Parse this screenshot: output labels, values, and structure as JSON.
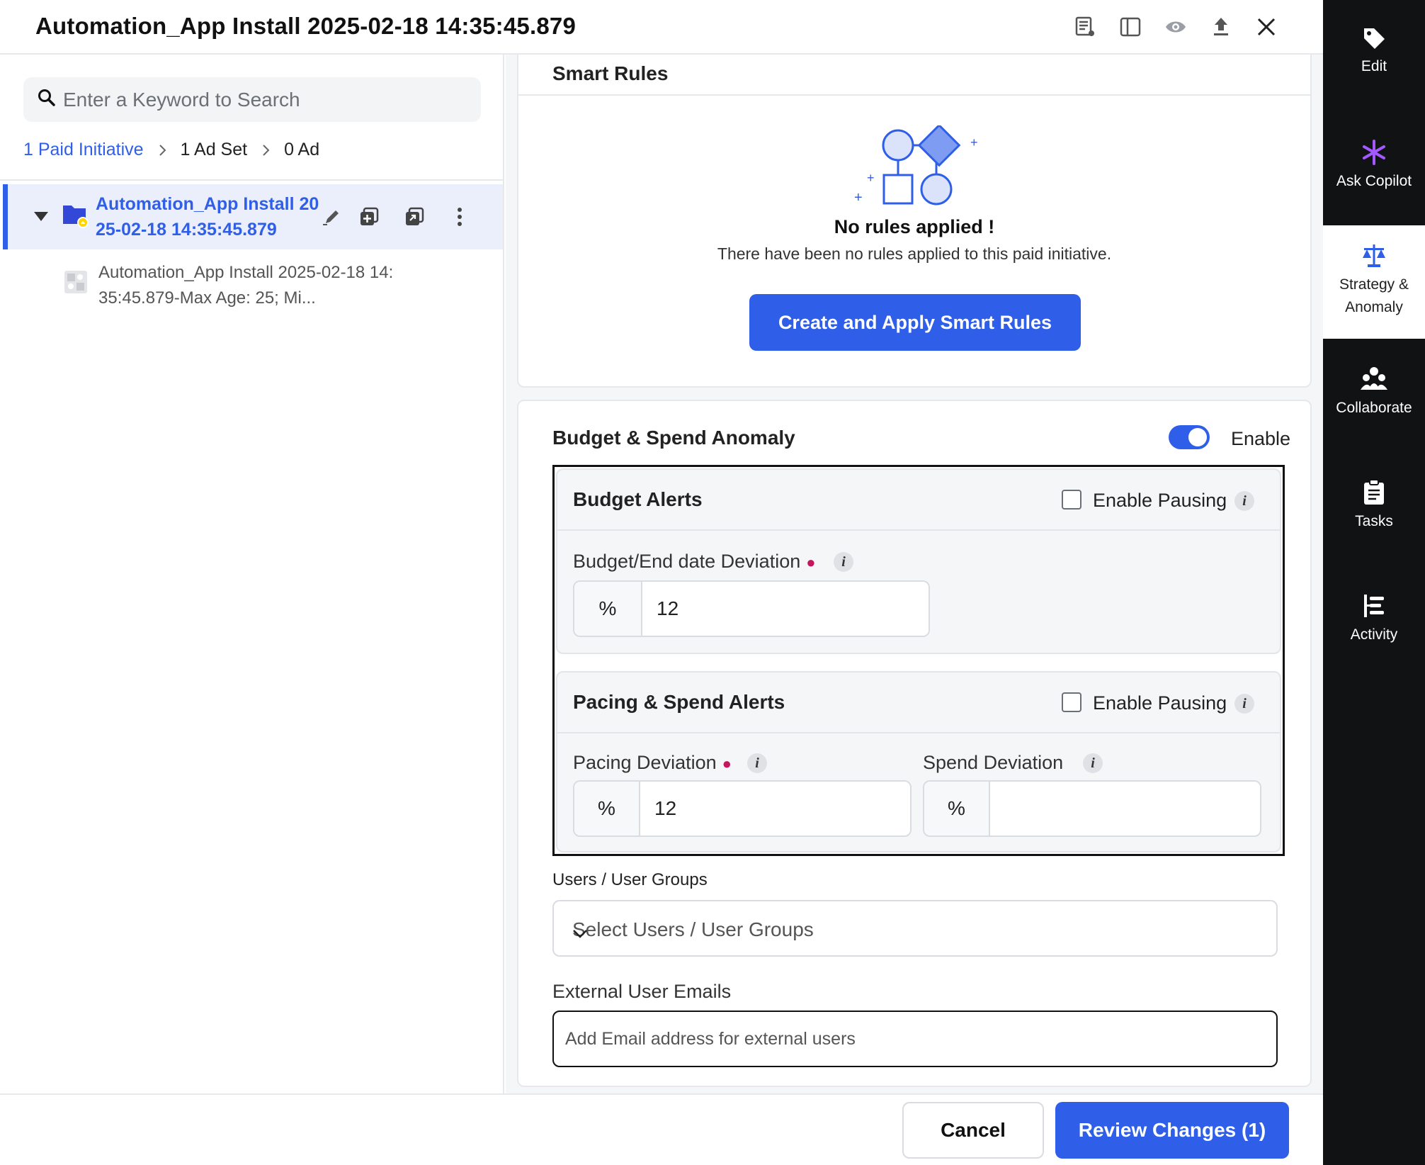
{
  "window": {
    "title": "Automation_App Install 2025-02-18 14:35:45.879"
  },
  "header_icons": [
    "list-settings-icon",
    "split-view-icon",
    "eye-icon",
    "upload-icon",
    "close-icon"
  ],
  "left": {
    "search_placeholder": "Enter a Keyword to Search",
    "breadcrumb": {
      "initiative": "1 Paid Initiative",
      "adset": "1 Ad Set",
      "ad": "0 Ad"
    },
    "tree_item": {
      "name": "Automation_App Install 2025-02-18 14:35:45.879"
    },
    "child_item": {
      "name": "Automation_App Install 2025-02-18 14:35:45.879-Max Age: 25; Mi..."
    }
  },
  "smart_rules": {
    "title": "Smart Rules",
    "empty_title": "No rules applied !",
    "empty_desc": "There have been no rules applied to this paid initiative.",
    "create_button": "Create and Apply Smart Rules"
  },
  "anomaly": {
    "title": "Budget & Spend Anomaly",
    "toggle_label": "Enable",
    "toggle_on": true,
    "budget_alerts": {
      "title": "Budget Alerts",
      "enable_pausing": "Enable Pausing",
      "field_label": "Budget/End date Deviation",
      "unit": "%",
      "value": "12"
    },
    "pacing_alerts": {
      "title": "Pacing & Spend Alerts",
      "enable_pausing": "Enable Pausing",
      "pacing_label": "Pacing Deviation",
      "pacing_unit": "%",
      "pacing_value": "12",
      "spend_label": "Spend Deviation",
      "spend_unit": "%",
      "spend_value": ""
    },
    "users_label": "Users / User Groups",
    "users_placeholder": "Select Users / User Groups",
    "emails_label": "External User Emails",
    "emails_placeholder": "Add Email address for external users"
  },
  "footer": {
    "cancel": "Cancel",
    "review": "Review Changes (1)"
  },
  "rail": [
    {
      "label": "Edit",
      "icon": "tag-icon"
    },
    {
      "label": "Ask Copilot",
      "icon": "sparkle-icon"
    },
    {
      "label1": "Strategy &",
      "label2": "Anomaly",
      "icon": "scale-icon"
    },
    {
      "label": "Collaborate",
      "icon": "people-icon"
    },
    {
      "label": "Tasks",
      "icon": "clipboard-icon"
    },
    {
      "label": "Activity",
      "icon": "activity-icon"
    }
  ],
  "colors": {
    "accent": "#2f5fe8",
    "rail_bg": "#111214",
    "copilot_accent": "#a259ff",
    "required": "#c2185b"
  }
}
